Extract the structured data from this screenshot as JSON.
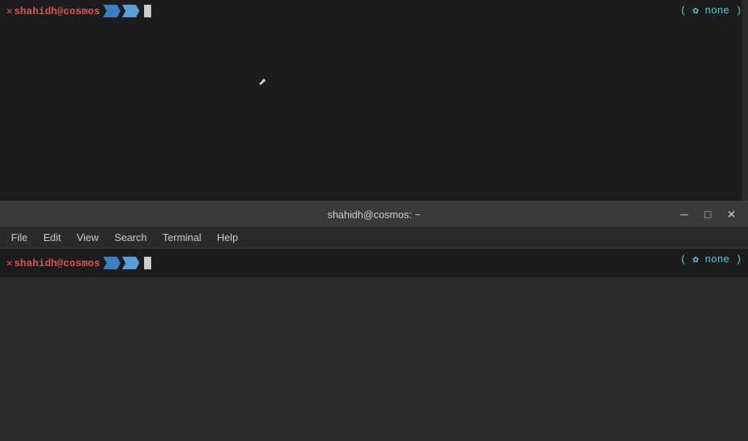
{
  "top_pane": {
    "prompt": {
      "x_mark": "✕",
      "username": "shahidh@cosmos",
      "right_info": "( ✿ none )"
    }
  },
  "bottom_window": {
    "title_bar": {
      "title": "shahidh@cosmos: ~",
      "minimize_label": "─",
      "restore_label": "□",
      "close_label": "✕"
    },
    "menu_bar": {
      "items": [
        {
          "label": "File"
        },
        {
          "label": "Edit"
        },
        {
          "label": "View"
        },
        {
          "label": "Search"
        },
        {
          "label": "Terminal"
        },
        {
          "label": "Help"
        }
      ]
    },
    "prompt": {
      "x_mark": "✕",
      "username": "shahidh@cosmos",
      "right_info": "( ✿ none )"
    }
  }
}
